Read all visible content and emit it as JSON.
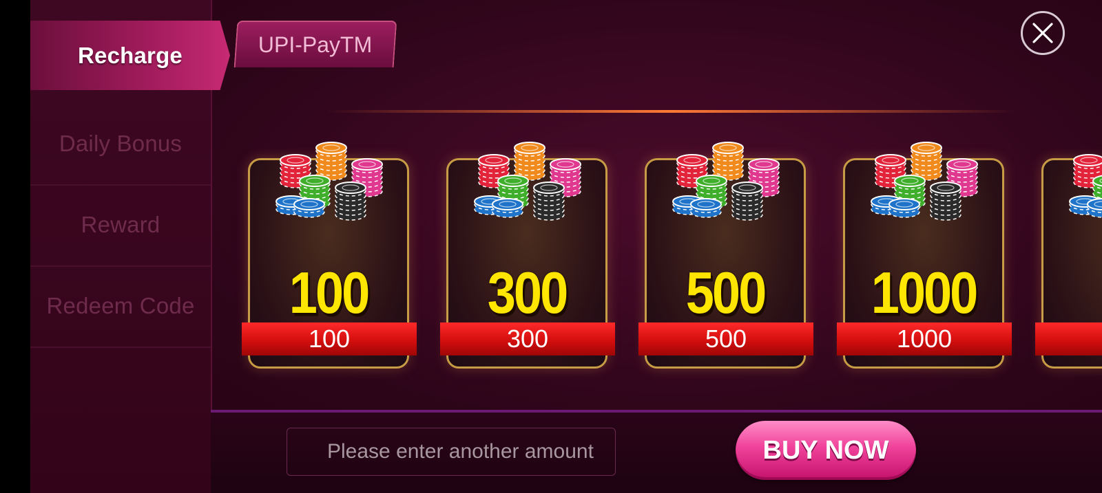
{
  "sidebar": {
    "items": [
      {
        "label": "Recharge",
        "active": true
      },
      {
        "label": "Daily Bonus",
        "active": false
      },
      {
        "label": "Reward",
        "active": false
      },
      {
        "label": "Redeem Code",
        "active": false
      }
    ]
  },
  "tabs": [
    {
      "label": "UPI-PayTM",
      "active": true
    }
  ],
  "packages": [
    {
      "amount": "100",
      "price": "100"
    },
    {
      "amount": "300",
      "price": "300"
    },
    {
      "amount": "500",
      "price": "500"
    },
    {
      "amount": "1000",
      "price": "1000"
    }
  ],
  "custom_amount": {
    "placeholder": "Please enter another amount",
    "value": ""
  },
  "buy_button": {
    "label": "BUY NOW"
  },
  "icons": {
    "close": "close-icon",
    "chips": "casino-chips-icon"
  },
  "colors": {
    "accent": "#c72a72",
    "amount": "#ffe600",
    "ribbon": "#d40e0e",
    "buy": "#f0429a"
  }
}
